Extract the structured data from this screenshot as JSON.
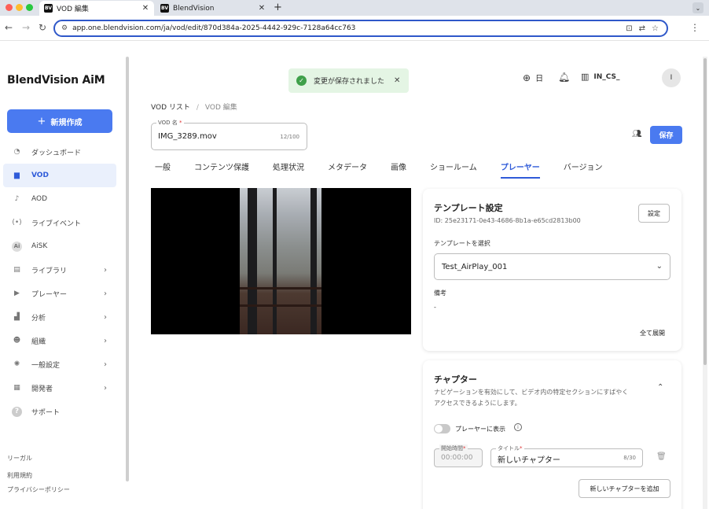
{
  "browser": {
    "tabs": [
      {
        "favicon": "BV",
        "title": "VOD 編集",
        "close": "✕"
      },
      {
        "favicon": "BV",
        "title": "BlendVision",
        "close": "✕"
      }
    ],
    "new_tab": "+",
    "tab_menu": "⌄",
    "url": "app.one.blendvision.com/ja/vod/edit/870d384a-2025-4442-929c-7128a64cc763"
  },
  "sidebar": {
    "logo": "BlendVision AiM",
    "create_button": "新規作成",
    "items": [
      {
        "label": "ダッシュボード",
        "icon": "dashboard-icon",
        "active": false,
        "chevron": false
      },
      {
        "label": "VOD",
        "icon": "vod-icon",
        "active": true,
        "chevron": false
      },
      {
        "label": "AOD",
        "icon": "music-note-icon",
        "active": false,
        "chevron": false
      },
      {
        "label": "ライブイベント",
        "icon": "live-icon",
        "active": false,
        "chevron": false
      },
      {
        "label": "AiSK",
        "icon": "ai-icon",
        "active": false,
        "chevron": false
      },
      {
        "label": "ライブラリ",
        "icon": "library-icon",
        "active": false,
        "chevron": true
      },
      {
        "label": "プレーヤー",
        "icon": "player-icon",
        "active": false,
        "chevron": true
      },
      {
        "label": "分析",
        "icon": "analytics-icon",
        "active": false,
        "chevron": true
      },
      {
        "label": "組織",
        "icon": "organization-icon",
        "active": false,
        "chevron": true
      },
      {
        "label": "一般設定",
        "icon": "gear-icon",
        "active": false,
        "chevron": true
      },
      {
        "label": "開発者",
        "icon": "developer-icon",
        "active": false,
        "chevron": true
      },
      {
        "label": "サポート",
        "icon": "help-icon",
        "active": false,
        "chevron": false
      }
    ],
    "footer": {
      "legal": "リーガル",
      "terms": "利用規約",
      "privacy": "プライバシーポリシー"
    }
  },
  "toast": {
    "message": "変更が保存されました"
  },
  "header": {
    "language": "日",
    "org": "IN_CS_",
    "avatar_initial": "I"
  },
  "breadcrumb": {
    "root": "VOD リスト",
    "current": "VOD 編集"
  },
  "vod_name": {
    "label": "VOD 名",
    "required": "*",
    "value": "IMG_3289.mov",
    "count": "12/100"
  },
  "save_button": "保存",
  "tabs": [
    {
      "label": "一般",
      "active": false
    },
    {
      "label": "コンテンツ保護",
      "active": false
    },
    {
      "label": "処理状況",
      "active": false
    },
    {
      "label": "メタデータ",
      "active": false
    },
    {
      "label": "画像",
      "active": false
    },
    {
      "label": "ショールーム",
      "active": false
    },
    {
      "label": "プレーヤー",
      "active": true
    },
    {
      "label": "バージョン",
      "active": false
    }
  ],
  "template_card": {
    "title": "テンプレート設定",
    "id_text": "ID: 25e23171-0e43-4686-8b1a-e65cd2813b00",
    "settings_button": "設定",
    "select_label": "テンプレートを選択",
    "selected": "Test_AirPlay_001",
    "note_label": "備考",
    "note_value": "-",
    "expand_all": "全て展開"
  },
  "chapter_card": {
    "title": "チャプター",
    "description": "ナビゲーションを有効にして、ビデオ内の特定セクションにすばやくアクセスできるようにします。",
    "toggle_label": "プレーヤーに表示",
    "toggle_on": false,
    "start_label": "開始時間",
    "start_value": "00:00:00",
    "title_label": "タイトル",
    "required": "*",
    "title_value": "新しいチャプター",
    "title_count": "8/30",
    "add_button": "新しいチャプターを追加"
  }
}
